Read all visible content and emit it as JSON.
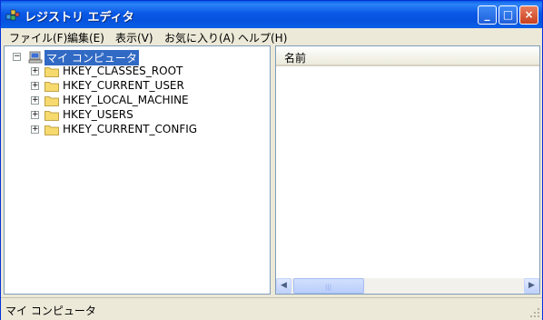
{
  "window": {
    "title": "レジストリ エディタ"
  },
  "titlebar": {
    "minimize": "_",
    "maximize": "□",
    "close": "×"
  },
  "menu": [
    {
      "label": "ファイル(F)"
    },
    {
      "label": "編集(E)"
    },
    {
      "label": "表示(V)"
    },
    {
      "label": "お気に入り(A)"
    },
    {
      "label": "ヘルプ(H)"
    }
  ],
  "tree": {
    "root": {
      "label": "マイ コンピュータ",
      "icon": "computer-icon"
    },
    "children": [
      {
        "label": "HKEY_CLASSES_ROOT",
        "icon": "folder-icon"
      },
      {
        "label": "HKEY_CURRENT_USER",
        "icon": "folder-icon"
      },
      {
        "label": "HKEY_LOCAL_MACHINE",
        "icon": "folder-icon"
      },
      {
        "label": "HKEY_USERS",
        "icon": "folder-icon"
      },
      {
        "label": "HKEY_CURRENT_CONFIG",
        "icon": "folder-icon"
      }
    ],
    "expand_symbol": "+",
    "collapse_symbol": "−"
  },
  "list": {
    "columns": [
      {
        "label": "名前"
      }
    ]
  },
  "scrollbar": {
    "left_arrow": "◀",
    "right_arrow": "▶",
    "grip": "|||"
  },
  "status": {
    "text": "マイ コンピュータ"
  },
  "colors": {
    "title_blue": "#0A5FE6",
    "selection": "#316AC5",
    "chrome": "#ECE9D8"
  }
}
